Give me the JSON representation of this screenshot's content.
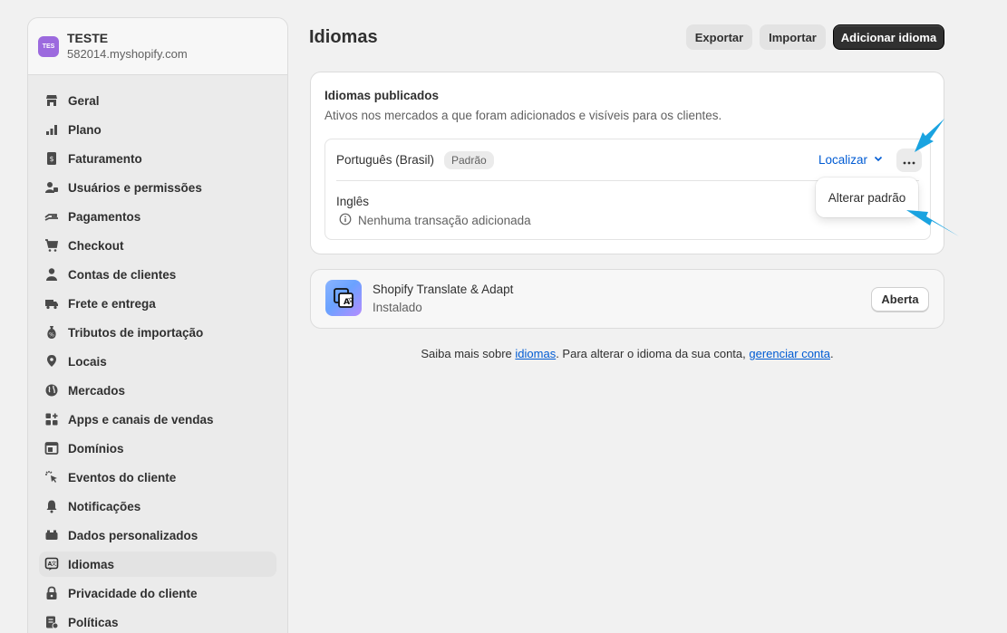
{
  "store": {
    "avatar_text": "TES",
    "name": "TESTE",
    "url": "582014.myshopify.com",
    "avatar_color": "#9c6ade"
  },
  "sidebar": {
    "items": [
      {
        "label": "Geral",
        "icon": "store-icon"
      },
      {
        "label": "Plano",
        "icon": "plan-chart-icon"
      },
      {
        "label": "Faturamento",
        "icon": "receipt-icon"
      },
      {
        "label": "Usuários e permissões",
        "icon": "users-icon"
      },
      {
        "label": "Pagamentos",
        "icon": "payment-hand-icon"
      },
      {
        "label": "Checkout",
        "icon": "cart-icon"
      },
      {
        "label": "Contas de clientes",
        "icon": "person-icon"
      },
      {
        "label": "Frete e entrega",
        "icon": "truck-icon"
      },
      {
        "label": "Tributos de importação",
        "icon": "money-bag-icon"
      },
      {
        "label": "Locais",
        "icon": "location-pin-icon"
      },
      {
        "label": "Mercados",
        "icon": "globe-icon"
      },
      {
        "label": "Apps e canais de vendas",
        "icon": "apps-grid-icon"
      },
      {
        "label": "Domínios",
        "icon": "domain-window-icon"
      },
      {
        "label": "Eventos do cliente",
        "icon": "cursor-click-icon"
      },
      {
        "label": "Notificações",
        "icon": "bell-icon"
      },
      {
        "label": "Dados personalizados",
        "icon": "data-box-icon"
      },
      {
        "label": "Idiomas",
        "icon": "language-icon",
        "active": true
      },
      {
        "label": "Privacidade do cliente",
        "icon": "lock-icon"
      },
      {
        "label": "Políticas",
        "icon": "policy-doc-icon"
      }
    ]
  },
  "header": {
    "title": "Idiomas",
    "export_label": "Exportar",
    "import_label": "Importar",
    "add_language_label": "Adicionar idioma"
  },
  "published": {
    "title": "Idiomas publicados",
    "subtitle": "Ativos nos mercados a que foram adicionados e visíveis para os clientes.",
    "languages": [
      {
        "name": "Português (Brasil)",
        "badge": "Padrão",
        "action_label": "Localizar"
      },
      {
        "name": "Inglês",
        "warning": "Nenhuma transação adicionada"
      }
    ],
    "popover_item": "Alterar padrão"
  },
  "app_card": {
    "name": "Shopify Translate & Adapt",
    "status": "Instalado",
    "open_label": "Aberta"
  },
  "footer": {
    "prefix": "Saiba mais sobre ",
    "link1": "idiomas",
    "middle": ". Para alterar o idioma da sua conta, ",
    "link2": "gerenciar conta",
    "suffix": "."
  },
  "colors": {
    "accent": "#005bd3",
    "annotation_arrow": "#1aa3e0",
    "primary_button": "#303030"
  }
}
